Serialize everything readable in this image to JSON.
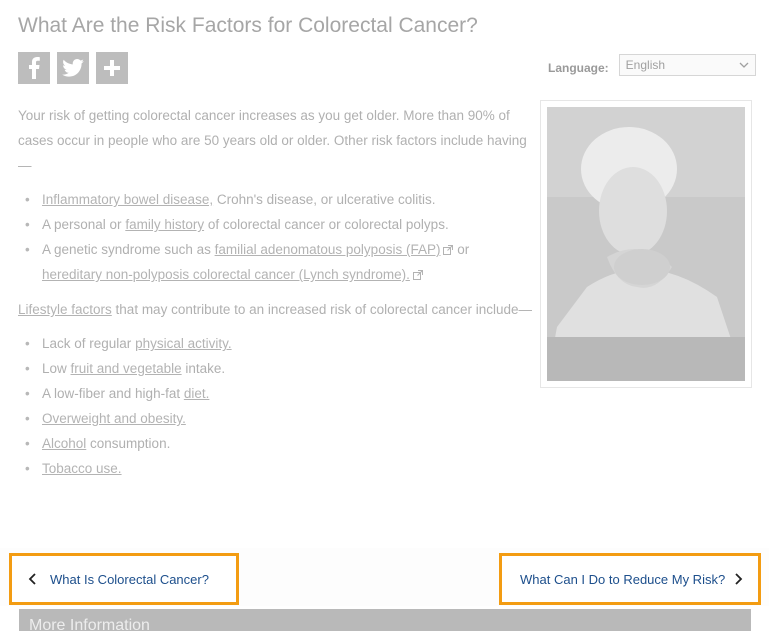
{
  "page": {
    "title": "What Are the Risk Factors for Colorectal Cancer?"
  },
  "social": {
    "facebook_icon": "facebook-icon",
    "twitter_icon": "twitter-icon",
    "share_icon": "plus-icon"
  },
  "language": {
    "label": "Language:",
    "selected": "English"
  },
  "content": {
    "intro": "Your risk of getting colorectal cancer increases as you get older. More than 90% of cases occur in people who are 50 years old or older. Other risk factors include having—",
    "risk_list": [
      {
        "link": "Inflammatory bowel disease,",
        "text": " Crohn's disease, or ulcerative colitis."
      },
      {
        "pre": "A personal or ",
        "link": "family history",
        "text": " of colorectal cancer or colorectal polyps."
      },
      {
        "pre": "A genetic syndrome such as ",
        "link": "familial adenomatous polyposis (FAP)",
        "text": " or ",
        "link2": "hereditary non-polyposis colorectal cancer (Lynch syndrome)."
      }
    ],
    "lifestyle_link": "Lifestyle factors",
    "lifestyle_text": " that may contribute to an increased risk of colorectal cancer include—",
    "lifestyle_list": [
      {
        "pre": "Lack of regular ",
        "link": "physical activity."
      },
      {
        "pre": "Low ",
        "link": "fruit and vegetable",
        "text": " intake."
      },
      {
        "pre": "A low-fiber and high-fat ",
        "link": "diet."
      },
      {
        "link": "Overweight and obesity."
      },
      {
        "link": "Alcohol",
        "text": " consumption."
      },
      {
        "link": "Tobacco use."
      }
    ]
  },
  "navigation": {
    "prev_label": "What Is Colorectal Cancer?",
    "next_label": "What Can I Do to Reduce My Risk?"
  },
  "more_info": {
    "title": "More Information"
  },
  "colors": {
    "highlight_border": "#f39c12",
    "nav_link": "#1d4f8c"
  }
}
